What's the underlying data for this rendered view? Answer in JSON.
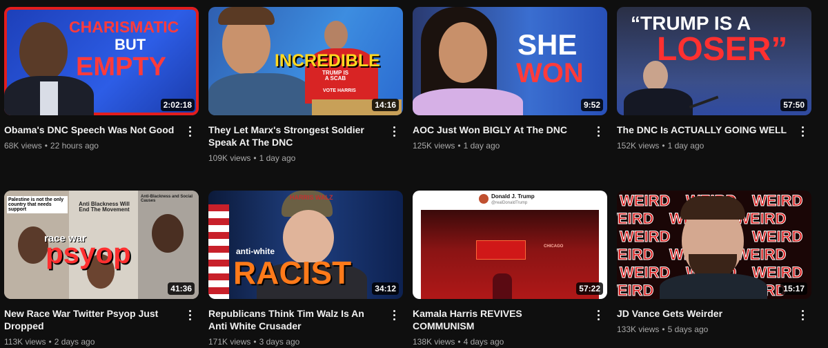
{
  "videos": [
    {
      "title": "Obama's DNC Speech Was Not Good",
      "views": "68K views",
      "age": "22 hours ago",
      "duration": "2:02:18",
      "overlay": [
        "CHARISMATIC",
        "BUT",
        "EMPTY"
      ]
    },
    {
      "title": "They Let Marx's Strongest Soldier Speak At The DNC",
      "views": "109K views",
      "age": "1 day ago",
      "duration": "14:16",
      "overlay": [
        "INCREDIBLE",
        "TRUMP IS A SCAB",
        "VOTE HARRIS"
      ]
    },
    {
      "title": "AOC Just Won BIGLY At The DNC",
      "views": "125K views",
      "age": "1 day ago",
      "duration": "9:52",
      "overlay": [
        "SHE",
        "WON"
      ]
    },
    {
      "title": "The DNC Is ACTUALLY GOING WELL",
      "views": "152K views",
      "age": "1 day ago",
      "duration": "57:50",
      "overlay": [
        "“TRUMP IS A",
        "LOSER”"
      ]
    },
    {
      "title": "New Race War Twitter Psyop Just Dropped",
      "views": "113K views",
      "age": "2 days ago",
      "duration": "41:36",
      "overlay": [
        "Palestine is not the only country that needs support",
        "Anti Blackness Will End The Movement",
        "Anti-Blackness and Social Causes",
        "race war",
        "psyop"
      ]
    },
    {
      "title": "Republicans Think Tim Walz Is An Anti White Crusader",
      "views": "171K views",
      "age": "3 days ago",
      "duration": "34:12",
      "overlay": [
        "anti-white",
        "RACIST",
        "HARRIS WALZ"
      ]
    },
    {
      "title": "Kamala Harris REVIVES COMMUNISM",
      "views": "138K views",
      "age": "4 days ago",
      "duration": "57:22",
      "overlay": [
        "Donald J. Trump",
        "@realDonaldTrump",
        "CHICAGO"
      ]
    },
    {
      "title": "JD Vance Gets Weirder",
      "views": "133K views",
      "age": "5 days ago",
      "duration": "15:17",
      "overlay": [
        "WEIRD"
      ]
    }
  ]
}
